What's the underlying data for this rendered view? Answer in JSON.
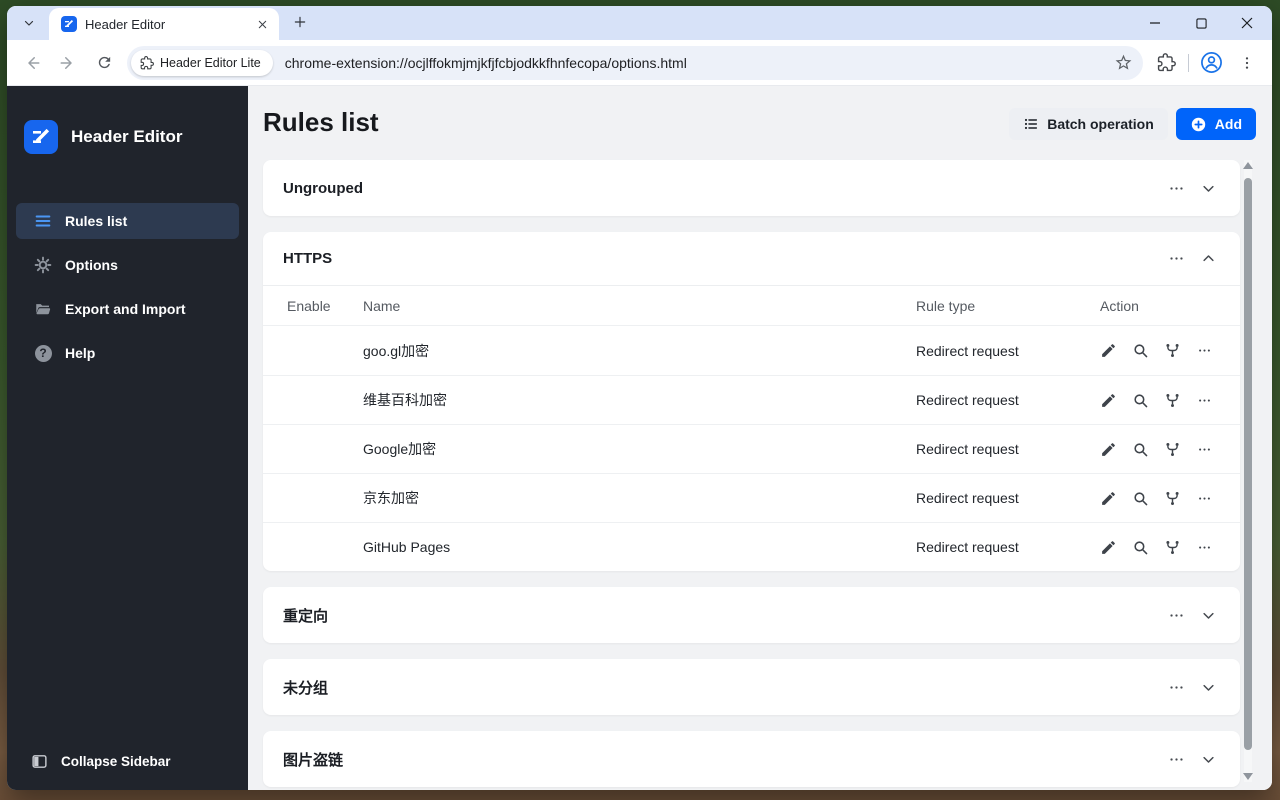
{
  "browser": {
    "tab_title": "Header Editor",
    "extension_chip": "Header Editor Lite",
    "url": "chrome-extension://ocjlffokmjmjkfjfcbjodkkfhnfecopa/options.html"
  },
  "sidebar": {
    "app_title": "Header Editor",
    "items": [
      {
        "label": "Rules list",
        "icon": "menu-icon",
        "active": true
      },
      {
        "label": "Options",
        "icon": "gear-icon",
        "active": false
      },
      {
        "label": "Export and Import",
        "icon": "folder-icon",
        "active": false
      },
      {
        "label": "Help",
        "icon": "help-icon",
        "active": false
      }
    ],
    "help_glyph": "?",
    "collapse_label": "Collapse Sidebar"
  },
  "main": {
    "title": "Rules list",
    "batch_button_label": "Batch operation",
    "add_button_label": "Add",
    "groups": [
      {
        "name": "Ungrouped",
        "expanded": false
      },
      {
        "name": "HTTPS",
        "expanded": true,
        "table": {
          "headers": [
            "Enable",
            "Name",
            "Rule type",
            "Action"
          ],
          "rows": [
            {
              "enabled": true,
              "name": "goo.gl加密",
              "rule_type": "Redirect request"
            },
            {
              "enabled": true,
              "name": "维基百科加密",
              "rule_type": "Redirect request"
            },
            {
              "enabled": true,
              "name": "Google加密",
              "rule_type": "Redirect request"
            },
            {
              "enabled": true,
              "name": "京东加密",
              "rule_type": "Redirect request"
            },
            {
              "enabled": true,
              "name": "GitHub Pages",
              "rule_type": "Redirect request"
            }
          ]
        }
      },
      {
        "name": "重定向",
        "expanded": false
      },
      {
        "name": "未分组",
        "expanded": false
      },
      {
        "name": "图片盗链",
        "expanded": false
      }
    ]
  },
  "colors": {
    "accent_blue": "#0064fa",
    "logo_blue": "#1766ee",
    "toggle_green": "#32b34a",
    "sidebar_bg": "#20242c",
    "selected_item_bg": "#2d3a50",
    "tabstrip_bg": "#d7e2f8"
  }
}
